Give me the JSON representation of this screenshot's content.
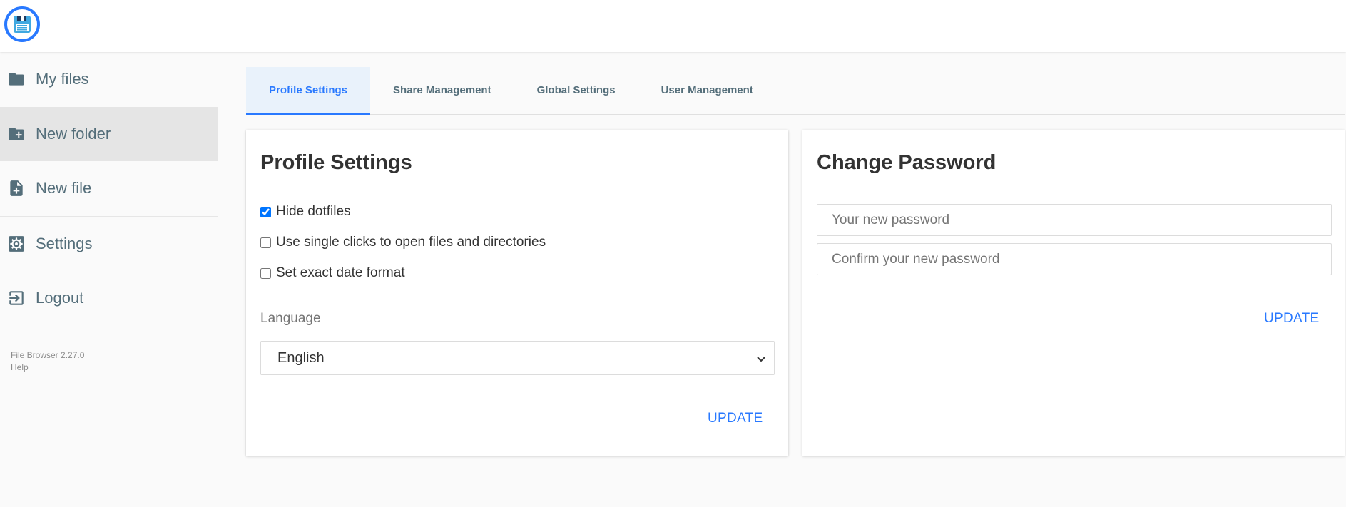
{
  "app": {
    "logo_icon": "floppy-disk-icon",
    "accent_color": "#2979ff"
  },
  "sidebar": {
    "items": [
      {
        "label": "My files",
        "icon": "folder-icon"
      },
      {
        "label": "New folder",
        "icon": "folder-plus-icon"
      },
      {
        "label": "New file",
        "icon": "file-plus-icon"
      },
      {
        "label": "Settings",
        "icon": "gear-icon"
      },
      {
        "label": "Logout",
        "icon": "logout-icon"
      }
    ],
    "version": "File Browser 2.27.0",
    "help": "Help"
  },
  "tabs": [
    {
      "label": "Profile Settings",
      "active": true
    },
    {
      "label": "Share Management",
      "active": false
    },
    {
      "label": "Global Settings",
      "active": false
    },
    {
      "label": "User Management",
      "active": false
    }
  ],
  "profile": {
    "title": "Profile Settings",
    "options": [
      {
        "label": "Hide dotfiles",
        "checked": true
      },
      {
        "label": "Use single clicks to open files and directories",
        "checked": false
      },
      {
        "label": "Set exact date format",
        "checked": false
      }
    ],
    "language_label": "Language",
    "language_value": "English",
    "update_label": "UPDATE"
  },
  "password": {
    "title": "Change Password",
    "new_placeholder": "Your new password",
    "confirm_placeholder": "Confirm your new password",
    "update_label": "UPDATE"
  }
}
